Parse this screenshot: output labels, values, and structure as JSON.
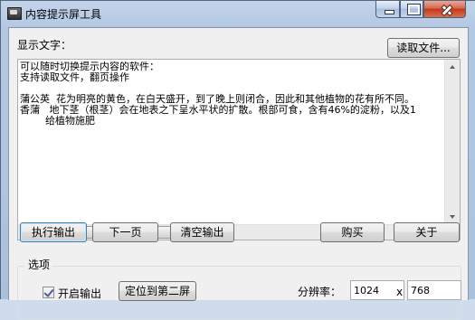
{
  "window": {
    "title": "内容提示屏工具"
  },
  "main": {
    "display_label": "显示文字：",
    "read_file_button": "读取文件...",
    "text_lines": [
      "可以随时切换提示内容的软件：",
      "支持读取文件，翻页操作",
      "",
      "蒲公英  花为明亮的黄色，在白天盛开，到了晚上则闭合，因此和其他植物的花有所不同。",
      "香蒲   地下茎（根茎）会在地表之下呈水平状的扩散。根部可食，含有46%的淀粉，以及1",
      "        给植物施肥"
    ]
  },
  "actions": {
    "execute_output": "执行输出",
    "next_page": "下一页",
    "clear_output": "清空输出",
    "buy": "购买",
    "about": "关于"
  },
  "options": {
    "group_title": "选项",
    "enable_output_label": "开启输出",
    "enable_output_checked": true,
    "locate_second_screen": "定位到第二屏",
    "resolution_label": "分辨率：",
    "resolution_width": "1024",
    "resolution_separator": "x",
    "resolution_height": "768"
  },
  "icons": {
    "app": "app-window-icon",
    "minimize": "minimize-icon",
    "maximize": "maximize-icon",
    "close": "close-icon"
  },
  "colors": {
    "close_button": "#c4371a",
    "title_bar": "#b3c8e3",
    "client_bg": "#f0f0f0"
  }
}
